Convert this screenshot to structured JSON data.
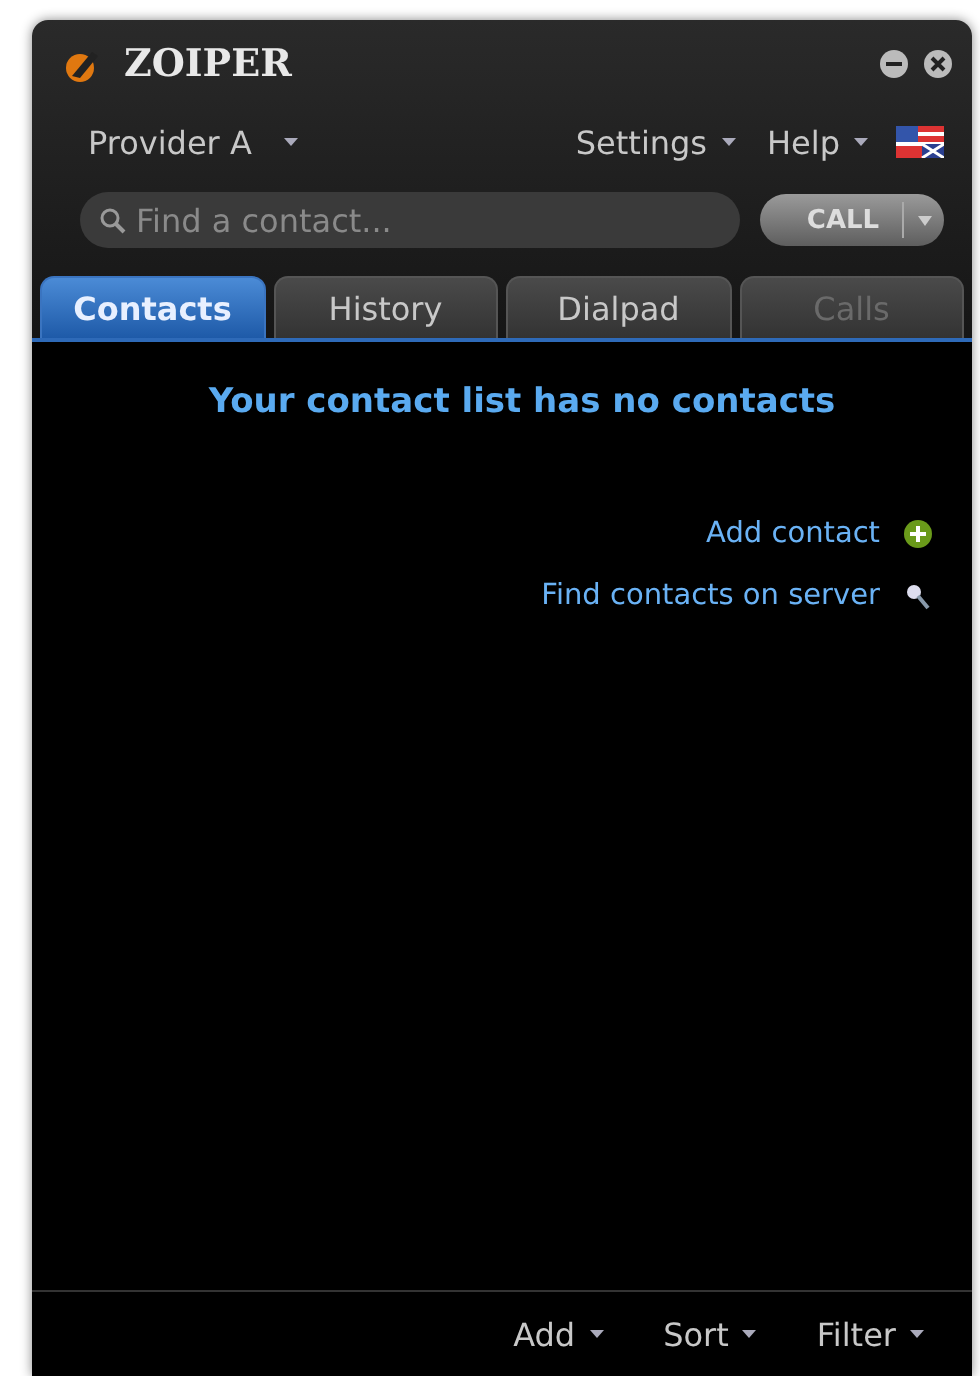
{
  "window": {
    "title": "ZOIPER"
  },
  "menu": [
    {
      "label": "Provider A",
      "kind": "dropdown"
    },
    {
      "label": "Settings",
      "kind": "dropdown"
    },
    {
      "label": "Help",
      "kind": "dropdown"
    }
  ],
  "search": {
    "placeholder": "Find a contact..."
  },
  "call_button": {
    "label": "CALL"
  },
  "tabs": [
    {
      "label": "Contacts",
      "selected": true,
      "disabled": false
    },
    {
      "label": "History",
      "selected": false,
      "disabled": false
    },
    {
      "label": "Dialpad",
      "selected": false,
      "disabled": false
    },
    {
      "label": "Calls",
      "selected": false,
      "disabled": true
    }
  ],
  "content": {
    "message": "Your contact list has no contacts",
    "actions": [
      {
        "label": "Add contact",
        "kind": "add"
      },
      {
        "label": "Find contacts on server",
        "kind": "search"
      }
    ]
  },
  "bottom_bar": [
    {
      "label": "Add"
    },
    {
      "label": "Sort"
    },
    {
      "label": "Filter"
    }
  ]
}
